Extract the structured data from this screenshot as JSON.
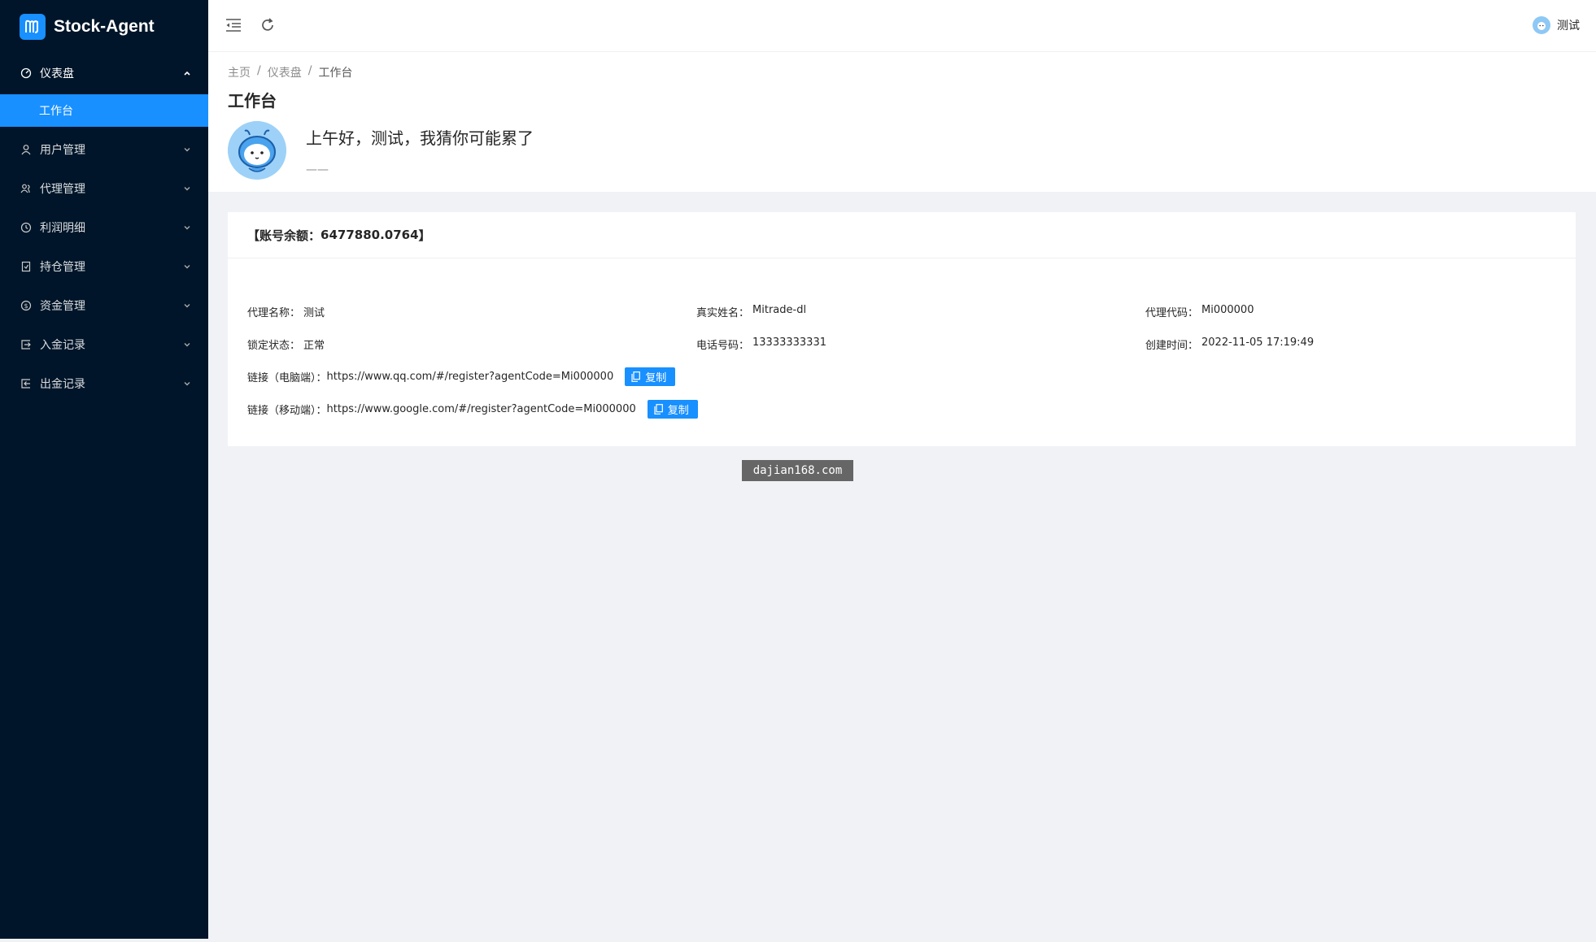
{
  "app": {
    "title": "Stock-Agent"
  },
  "sidebar": {
    "items": [
      {
        "label": "仪表盘",
        "icon": "dashboard-icon",
        "open": true,
        "children": [
          {
            "label": "工作台",
            "active": true
          }
        ]
      },
      {
        "label": "用户管理",
        "icon": "user-icon"
      },
      {
        "label": "代理管理",
        "icon": "team-icon"
      },
      {
        "label": "利润明细",
        "icon": "profit-icon"
      },
      {
        "label": "持仓管理",
        "icon": "position-icon"
      },
      {
        "label": "资金管理",
        "icon": "money-icon"
      },
      {
        "label": "入金记录",
        "icon": "deposit-icon"
      },
      {
        "label": "出金记录",
        "icon": "withdraw-icon"
      }
    ]
  },
  "header": {
    "user_name": "测试"
  },
  "breadcrumb": [
    "主页",
    "仪表盘",
    "工作台"
  ],
  "page": {
    "title": "工作台",
    "greeting": "上午好，测试，我猜你可能累了",
    "greeting_sub": "——"
  },
  "card": {
    "balance_label": "【账号余额：",
    "balance_value": "6477880.0764",
    "balance_suffix": "】",
    "fields": {
      "agent_name_label": "代理名称：",
      "agent_name": "测试",
      "real_name_label": "真实姓名：",
      "real_name": "Mitrade-dl",
      "agent_code_label": "代理代码：",
      "agent_code": "Mi000000",
      "lock_status_label": "锁定状态：",
      "lock_status": "正常",
      "phone_label": "电话号码：",
      "phone": "13333333331",
      "created_label": "创建时间：",
      "created": "2022-11-05 17:19:49"
    },
    "links": {
      "pc_label": "链接（电脑端）：",
      "pc_url": "https://www.qq.com/#/register?agentCode=Mi000000",
      "mobile_label": "链接（移动端）：",
      "mobile_url": "https://www.google.com/#/register?agentCode=Mi000000",
      "copy_label": "复制"
    }
  },
  "watermark": "dajian168.com",
  "colors": {
    "sidebar_bg": "#001529",
    "primary": "#1890ff",
    "content_bg": "#f0f2f5"
  }
}
